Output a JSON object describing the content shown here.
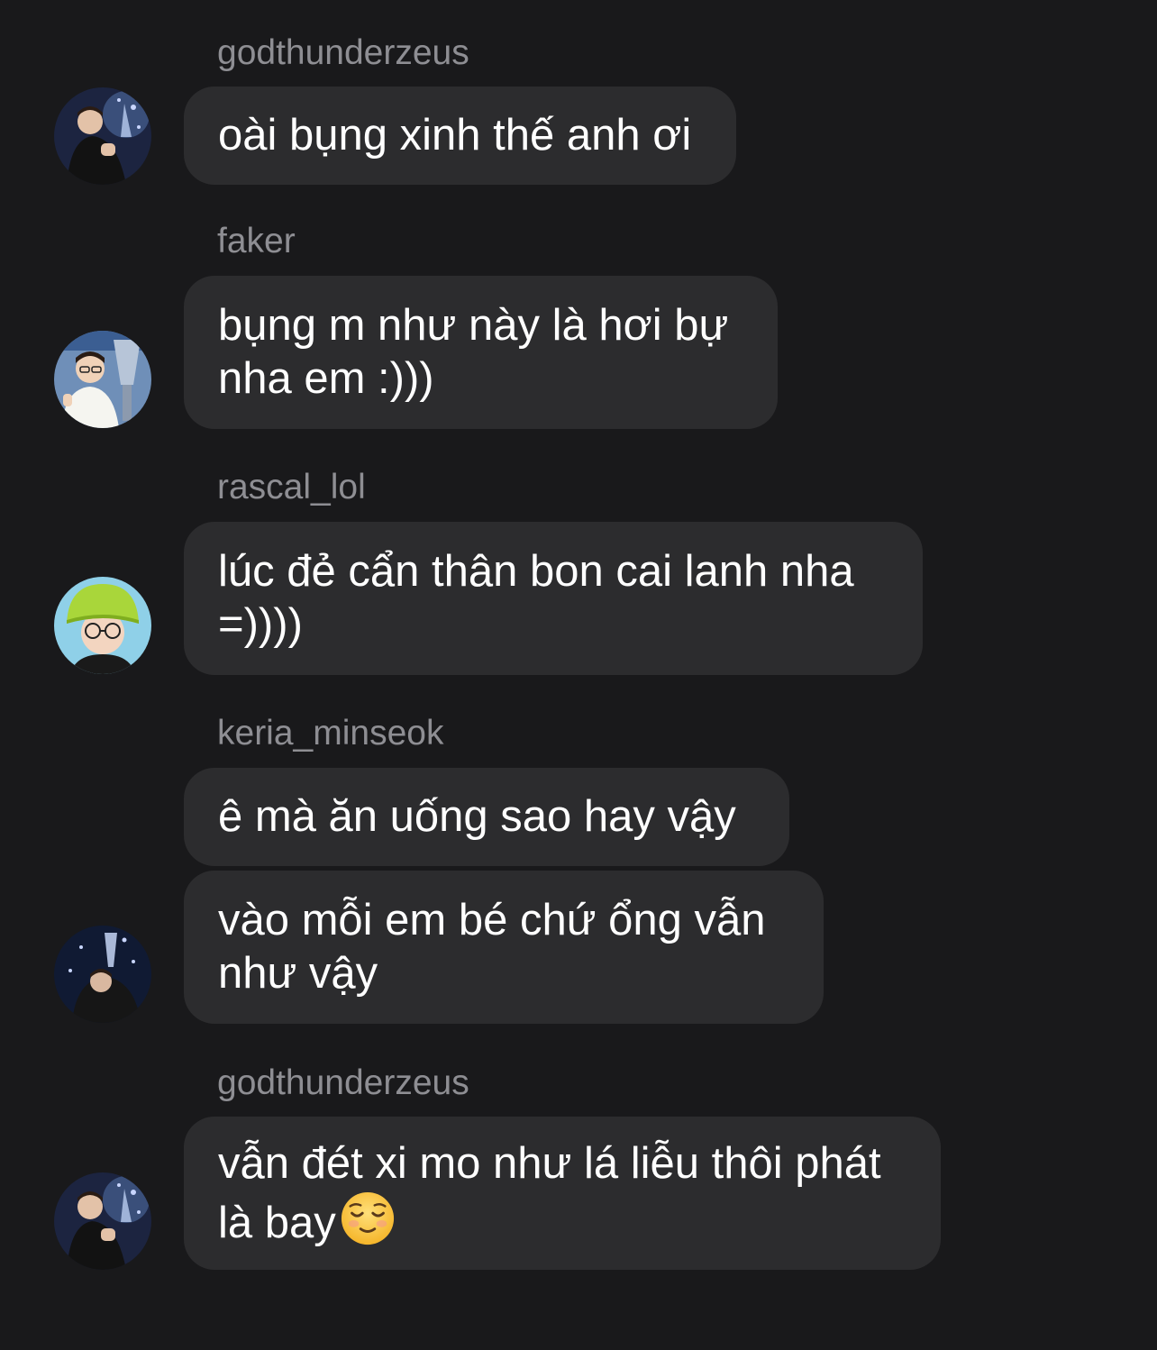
{
  "messages": [
    {
      "username": "godthunderzeus",
      "bubbles": [
        "oài bụng xinh thế anh ơi"
      ]
    },
    {
      "username": "faker",
      "bubbles": [
        "bụng m như này là hơi bự\nnha em :)))"
      ]
    },
    {
      "username": "rascal_lol",
      "bubbles": [
        "lúc đẻ cẩn thân bon cai lanh nha\n=))))"
      ]
    },
    {
      "username": "keria_minseok",
      "bubbles": [
        "ê mà ăn uống sao hay vậy",
        "vào mỗi em bé chứ ổng vẫn\nnhư vậy"
      ]
    },
    {
      "username": "godthunderzeus",
      "bubbles": [
        "vẫn đét xi mo như lá liễu thôi phát\nlà bay"
      ],
      "emoji": "relieved-face"
    }
  ],
  "avatars": [
    "zeus-avatar",
    "faker-avatar",
    "rascal-avatar",
    "keria-avatar",
    "zeus-avatar"
  ],
  "colors": {
    "background": "#19191b",
    "bubble": "#2c2c2e",
    "username": "#8e8e93",
    "text": "#ffffff"
  }
}
